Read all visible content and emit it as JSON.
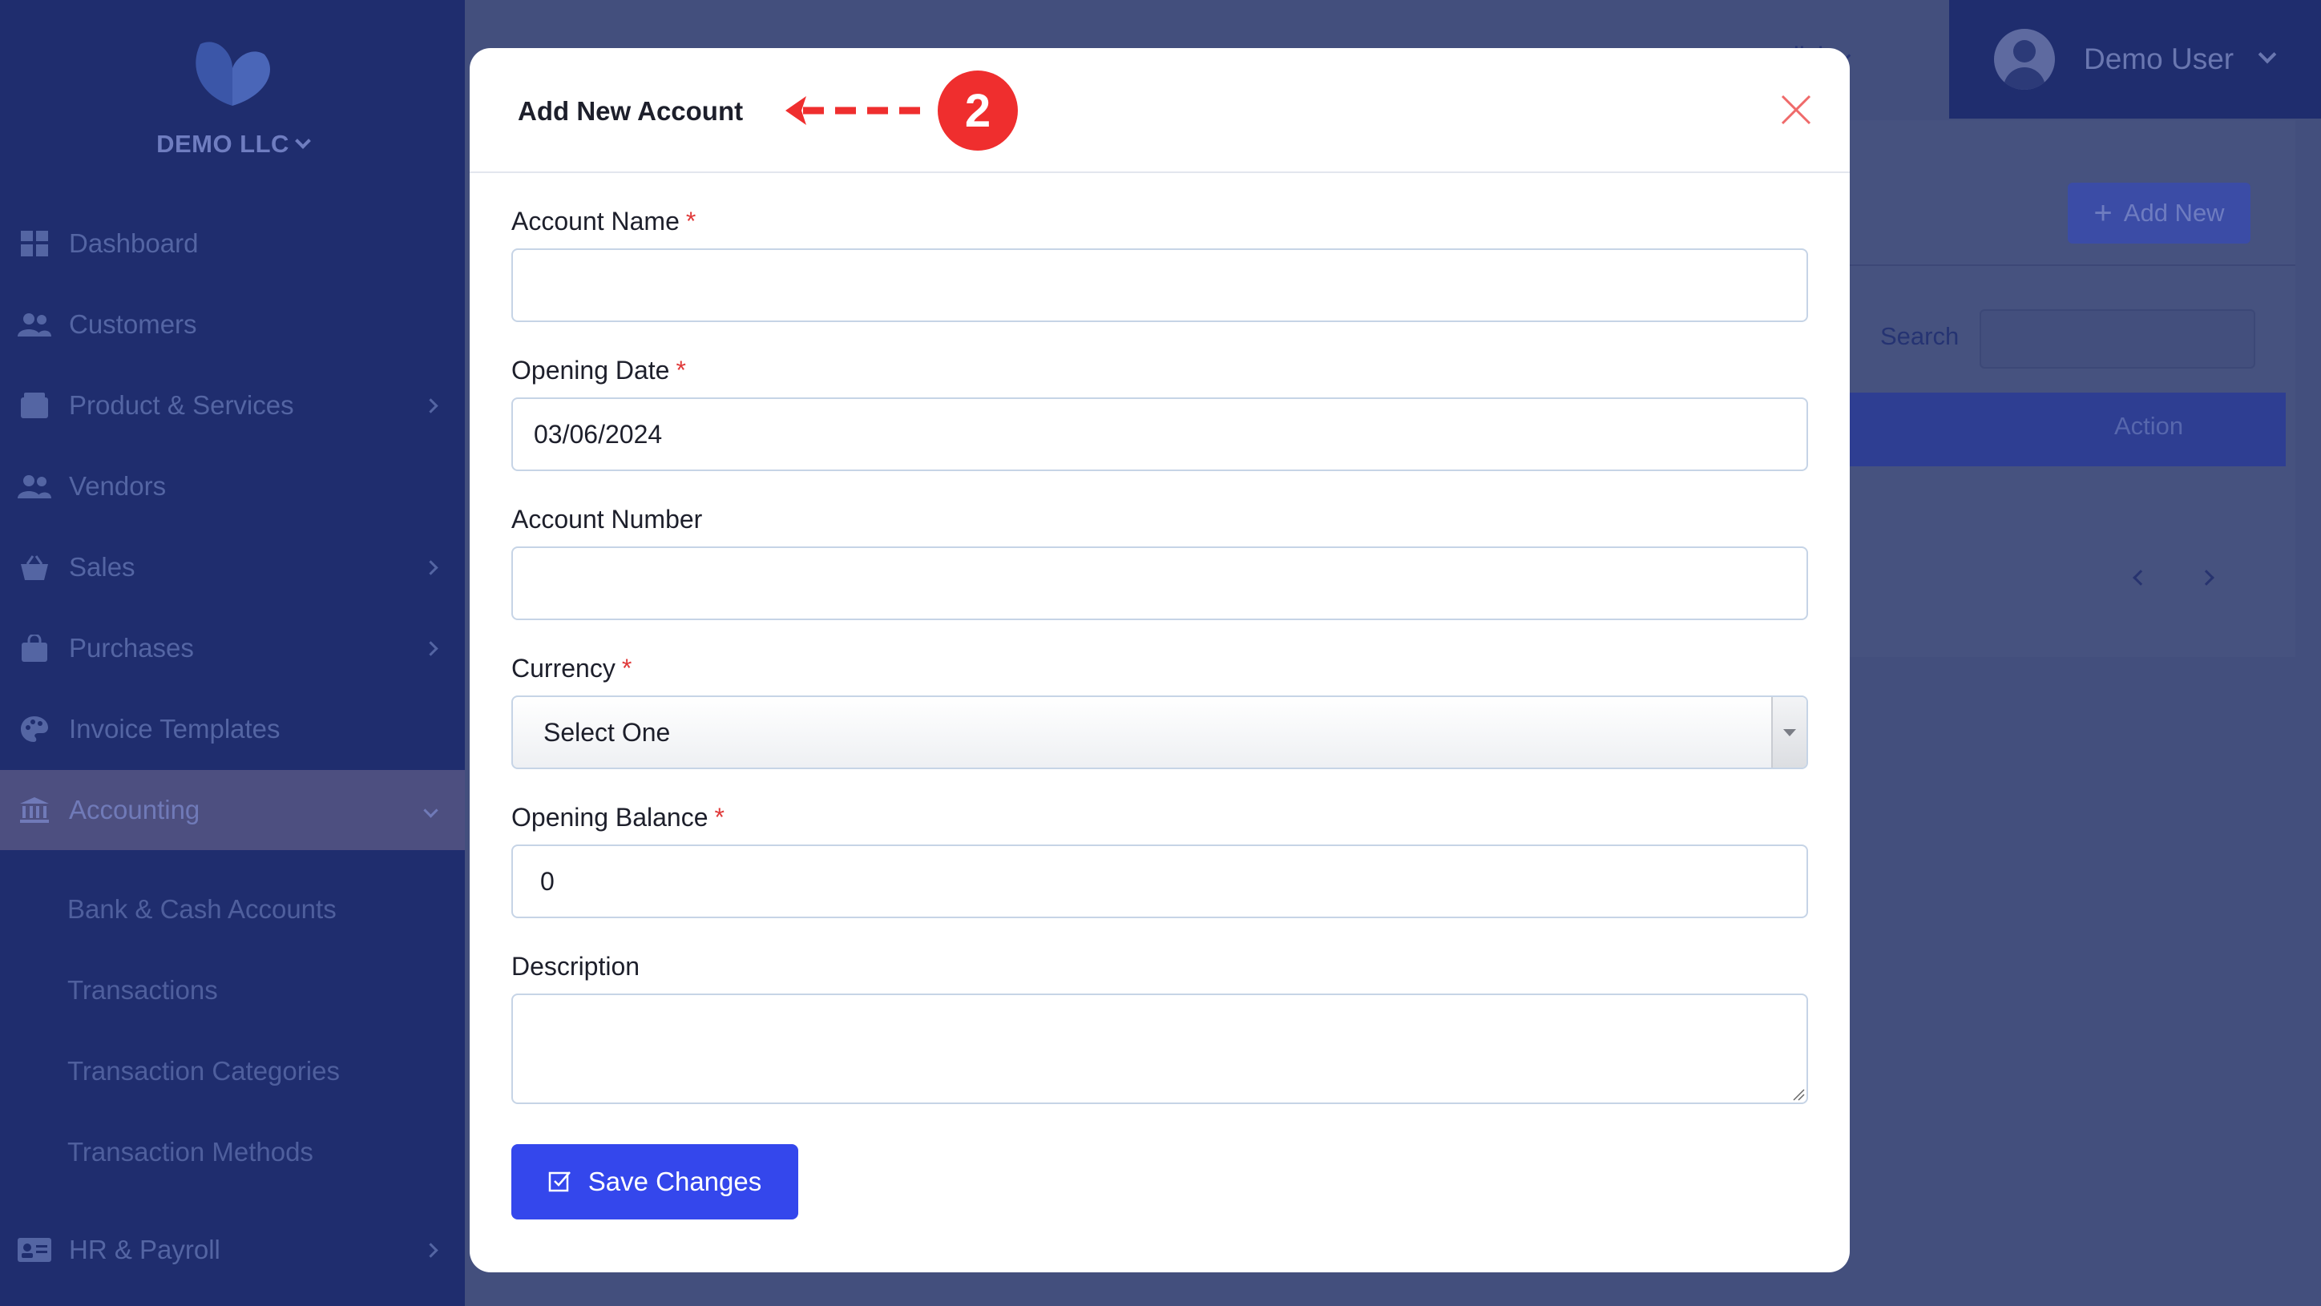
{
  "brand": {
    "name": "DEMO LLC"
  },
  "sidebar": {
    "items": [
      {
        "label": "Dashboard",
        "icon": "dashboard-icon"
      },
      {
        "label": "Customers",
        "icon": "users-icon"
      },
      {
        "label": "Product & Services",
        "icon": "box-icon"
      },
      {
        "label": "Vendors",
        "icon": "users-icon"
      },
      {
        "label": "Sales",
        "icon": "basket-icon"
      },
      {
        "label": "Purchases",
        "icon": "bag-icon"
      },
      {
        "label": "Invoice Templates",
        "icon": "palette-icon"
      },
      {
        "label": "Accounting",
        "icon": "bank-icon"
      },
      {
        "label": "HR & Payroll",
        "icon": "id-card-icon"
      }
    ],
    "accounting_sub": [
      "Bank & Cash Accounts",
      "Transactions",
      "Transaction Categories",
      "Transaction Methods"
    ]
  },
  "header": {
    "language": "glish",
    "user": "Demo User"
  },
  "page": {
    "add_new": "Add New",
    "search_label": "Search",
    "action_col": "Action"
  },
  "modal": {
    "title": "Add New Account",
    "callout_number": "2",
    "fields": {
      "account_name": {
        "label": "Account Name",
        "value": ""
      },
      "opening_date": {
        "label": "Opening Date",
        "value": "03/06/2024"
      },
      "account_number": {
        "label": "Account Number",
        "value": ""
      },
      "currency": {
        "label": "Currency",
        "selected": "Select One"
      },
      "opening_balance": {
        "label": "Opening Balance",
        "value": "0"
      },
      "description": {
        "label": "Description",
        "value": ""
      }
    },
    "required_marker": "*",
    "save_label": "Save Changes"
  },
  "colors": {
    "sidebar": "#1f2d6e",
    "primary": "#3447ec",
    "callout": "#ef2e2e",
    "overlay": "#434f7d"
  }
}
